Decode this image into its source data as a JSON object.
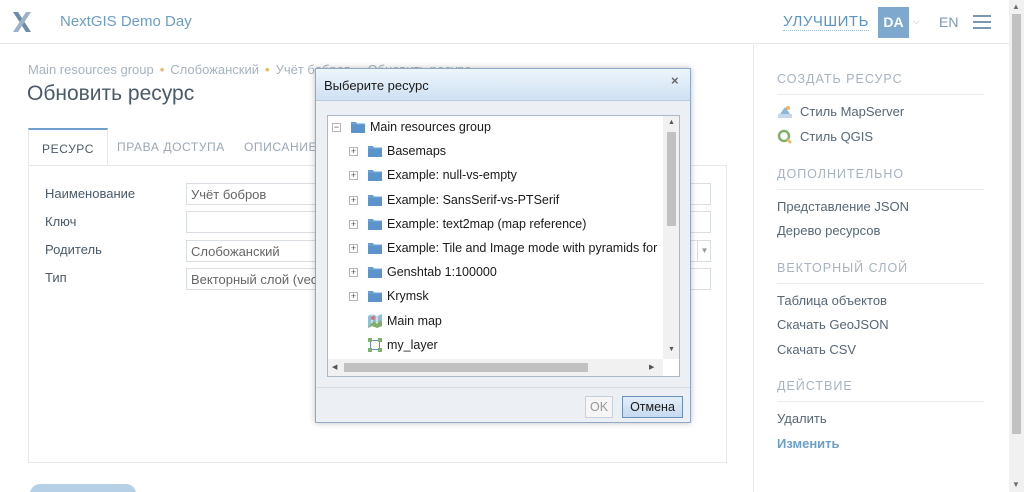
{
  "header": {
    "app_title": "NextGIS Demo Day",
    "upgrade_label": "УЛУЧШИТЬ",
    "avatar_initials": "DA",
    "language": "EN"
  },
  "breadcrumb": [
    "Main resources group",
    "Слобожанский",
    "Учёт бобров",
    "Обновить ресурс"
  ],
  "page_title": "Обновить ресурс",
  "tabs": [
    {
      "label": "РЕСУРС",
      "active": true
    },
    {
      "label": "ПРАВА ДОСТУПА",
      "active": false
    },
    {
      "label": "ОПИСАНИЕ",
      "active": false
    }
  ],
  "form": {
    "name_label": "Наименование",
    "name_value": "Учёт бобров",
    "key_label": "Ключ",
    "key_value": "",
    "parent_label": "Родитель",
    "parent_value": "Слобожанский",
    "type_label": "Тип",
    "type_value": "Векторный слой (vec"
  },
  "sidebar": {
    "create_heading": "СОЗДАТЬ РЕСУРС",
    "create_items": [
      "Стиль MapServer",
      "Стиль QGIS"
    ],
    "extra_heading": "ДОПОЛНИТЕЛЬНО",
    "extra_items": [
      "Представление JSON",
      "Дерево ресурсов"
    ],
    "vector_heading": "ВЕКТОРНЫЙ СЛОЙ",
    "vector_items": [
      "Таблица объектов",
      "Скачать GeoJSON",
      "Скачать CSV"
    ],
    "action_heading": "ДЕЙСТВИЕ",
    "action_items": [
      "Удалить",
      "Изменить"
    ]
  },
  "dialog": {
    "title": "Выберите ресурс",
    "close_glyph": "×",
    "ok_label": "OK",
    "cancel_label": "Отмена",
    "tree": [
      {
        "label": "Main resources group",
        "kind": "folder",
        "expander": "−",
        "depth": 0
      },
      {
        "label": "Basemaps",
        "kind": "folder",
        "expander": "+",
        "depth": 1
      },
      {
        "label": "Example: null-vs-empty",
        "kind": "folder",
        "expander": "+",
        "depth": 1
      },
      {
        "label": "Example: SansSerif-vs-PTSerif",
        "kind": "folder",
        "expander": "+",
        "depth": 1
      },
      {
        "label": "Example: text2map (map reference)",
        "kind": "folder",
        "expander": "+",
        "depth": 1
      },
      {
        "label": "Example: Tile and Image mode with pyramids for",
        "kind": "folder",
        "expander": "+",
        "depth": 1
      },
      {
        "label": "Genshtab 1:100000",
        "kind": "folder",
        "expander": "+",
        "depth": 1
      },
      {
        "label": "Krymsk",
        "kind": "folder",
        "expander": "+",
        "depth": 1
      },
      {
        "label": "Main map",
        "kind": "map",
        "expander": "",
        "depth": 1
      },
      {
        "label": "my_layer",
        "kind": "vector",
        "expander": "",
        "depth": 1
      }
    ]
  },
  "colors": {
    "accent": "#6da0cd",
    "breadcrumb_dot": "#f0b45a",
    "folder": "#6a9fd4"
  }
}
